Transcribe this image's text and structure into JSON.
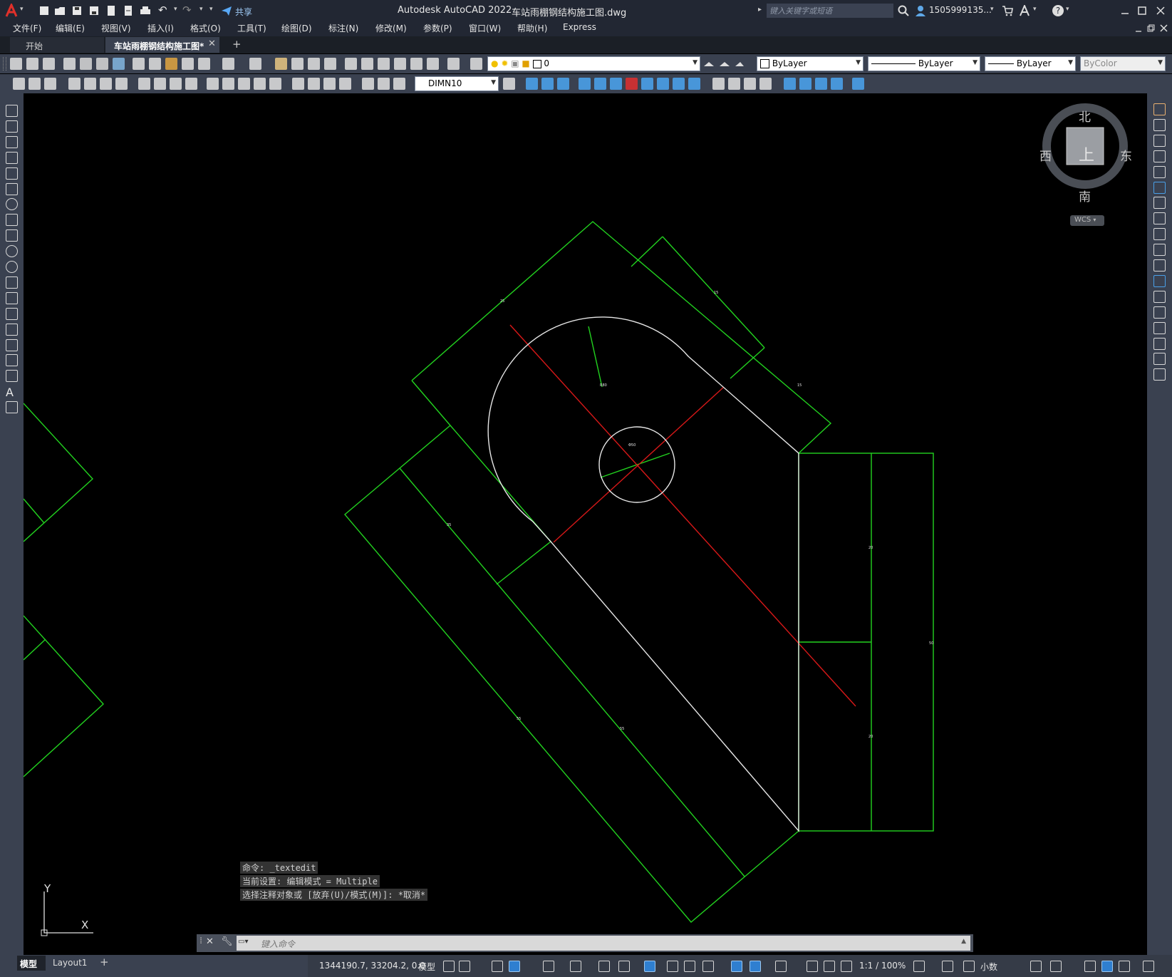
{
  "title_bar": {
    "app_name": "Autodesk AutoCAD 2022",
    "file_name": "车站雨棚钢结构施工图.dwg",
    "share_label": "共享",
    "search_placeholder": "键入关键字或短语",
    "user_name": "1505999135...",
    "logo_icon": "autocad-a-logo"
  },
  "menu": {
    "items": [
      "文件(F)",
      "编辑(E)",
      "视图(V)",
      "插入(I)",
      "格式(O)",
      "工具(T)",
      "绘图(D)",
      "标注(N)",
      "修改(M)",
      "参数(P)",
      "窗口(W)",
      "帮助(H)",
      "Express"
    ]
  },
  "tabs": {
    "start_label": "开始",
    "doc_label": "车站雨棚钢结构施工图*",
    "add_icon": "plus-icon",
    "close_icon": "close-icon"
  },
  "toolbar": {
    "layer_value": "0",
    "color_value": "ByLayer",
    "linetype_value": "ByLayer",
    "lineweight_value": "ByLayer",
    "plotstyle_value": "ByColor",
    "dimstyle_value": "DIMN10"
  },
  "viewcube": {
    "north": "北",
    "south": "南",
    "east": "东",
    "west": "西",
    "face": "上",
    "wcs_label": "WCS"
  },
  "ucs": {
    "x_label": "X",
    "y_label": "Y"
  },
  "command": {
    "history": [
      "命令: _textedit",
      "当前设置: 编辑模式 = Multiple",
      "选择注释对象或 [放弃(U)/模式(M)]: *取消*"
    ],
    "input_placeholder": "键入命令"
  },
  "layout_tabs": {
    "model_label": "模型",
    "layout1_label": "Layout1"
  },
  "status": {
    "coordinates": "1344190.7, 33204.2, 0.0",
    "model_label": "模型",
    "scale_label": "1:1 / 100%",
    "units_label": "小数"
  },
  "colors": {
    "title_bg": "#222733",
    "toolbar_bg": "#3a4150",
    "canvas_bg": "#000000",
    "green_line": "#22d21f",
    "red_line": "#d81818",
    "white_line": "#e6e6e6"
  }
}
